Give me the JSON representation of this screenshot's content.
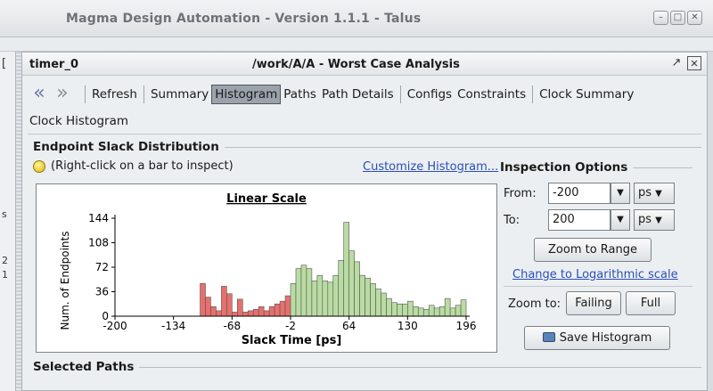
{
  "app": {
    "title": "Magma Design Automation - Version 1.1.1 - Talus",
    "window_buttons": [
      "–",
      "□",
      "✕"
    ]
  },
  "left_panel": {
    "bracket": "[",
    "fragments": [
      "s",
      "2",
      "1"
    ]
  },
  "panel": {
    "name": "timer_0",
    "title": "/work/A/A  -  Worst Case Analysis",
    "icons": [
      "restore-icon",
      "close-icon"
    ]
  },
  "toolbar": {
    "items": [
      "Refresh",
      "Summary",
      "Histogram",
      "Paths",
      "Path Details",
      "Configs",
      "Constraints",
      "Clock Summary"
    ],
    "row2_item": "Clock Histogram",
    "active": "Histogram"
  },
  "endpoint": {
    "section_title": "Endpoint Slack Distribution",
    "hint": "(Right-click on a bar to inspect)",
    "customize_link": "Customize Histogram..."
  },
  "chart_data": {
    "type": "bar",
    "title": "Linear Scale",
    "xlabel": "Slack Time [ps]",
    "ylabel": "Num. of Endpoints",
    "ylim": [
      0,
      144
    ],
    "xlim": [
      -200,
      200
    ],
    "y_ticks": [
      "144",
      "108",
      "72",
      "36",
      "0"
    ],
    "x_ticks": [
      "-200",
      "-134",
      "-68",
      "-2",
      "64",
      "130",
      "196"
    ],
    "grid": false,
    "colors": {
      "failing": "#e8706c",
      "passing": "#b9dca2",
      "outline": "#555555"
    },
    "bin_width": 6,
    "bins": [
      {
        "x": -101,
        "value": 48,
        "failing": true
      },
      {
        "x": -95,
        "value": 28,
        "failing": true
      },
      {
        "x": -89,
        "value": 14,
        "failing": true
      },
      {
        "x": -83,
        "value": 8,
        "failing": true
      },
      {
        "x": -77,
        "value": 44,
        "failing": true
      },
      {
        "x": -71,
        "value": 33,
        "failing": true
      },
      {
        "x": -65,
        "value": 6,
        "failing": true
      },
      {
        "x": -59,
        "value": 25,
        "failing": true
      },
      {
        "x": -53,
        "value": 6,
        "failing": true
      },
      {
        "x": -47,
        "value": 8,
        "failing": true
      },
      {
        "x": -41,
        "value": 10,
        "failing": true
      },
      {
        "x": -35,
        "value": 14,
        "failing": true
      },
      {
        "x": -29,
        "value": 8,
        "failing": true
      },
      {
        "x": -23,
        "value": 14,
        "failing": true
      },
      {
        "x": -17,
        "value": 18,
        "failing": true
      },
      {
        "x": -11,
        "value": 22,
        "failing": true
      },
      {
        "x": -5,
        "value": 30,
        "failing": true
      },
      {
        "x": 1,
        "value": 48,
        "failing": false
      },
      {
        "x": 7,
        "value": 70,
        "failing": false
      },
      {
        "x": 13,
        "value": 75,
        "failing": false
      },
      {
        "x": 19,
        "value": 70,
        "failing": false
      },
      {
        "x": 25,
        "value": 52,
        "failing": false
      },
      {
        "x": 31,
        "value": 60,
        "failing": false
      },
      {
        "x": 37,
        "value": 52,
        "failing": false
      },
      {
        "x": 43,
        "value": 50,
        "failing": false
      },
      {
        "x": 49,
        "value": 60,
        "failing": false
      },
      {
        "x": 55,
        "value": 82,
        "failing": false
      },
      {
        "x": 61,
        "value": 138,
        "failing": false
      },
      {
        "x": 67,
        "value": 96,
        "failing": false
      },
      {
        "x": 73,
        "value": 80,
        "failing": false
      },
      {
        "x": 79,
        "value": 60,
        "failing": false
      },
      {
        "x": 85,
        "value": 56,
        "failing": false
      },
      {
        "x": 91,
        "value": 48,
        "failing": false
      },
      {
        "x": 97,
        "value": 40,
        "failing": false
      },
      {
        "x": 103,
        "value": 34,
        "failing": false
      },
      {
        "x": 109,
        "value": 26,
        "failing": false
      },
      {
        "x": 115,
        "value": 20,
        "failing": false
      },
      {
        "x": 121,
        "value": 18,
        "failing": false
      },
      {
        "x": 127,
        "value": 18,
        "failing": false
      },
      {
        "x": 133,
        "value": 22,
        "failing": false
      },
      {
        "x": 139,
        "value": 14,
        "failing": false
      },
      {
        "x": 145,
        "value": 12,
        "failing": false
      },
      {
        "x": 151,
        "value": 10,
        "failing": false
      },
      {
        "x": 157,
        "value": 16,
        "failing": false
      },
      {
        "x": 163,
        "value": 12,
        "failing": false
      },
      {
        "x": 169,
        "value": 14,
        "failing": false
      },
      {
        "x": 175,
        "value": 26,
        "failing": false
      },
      {
        "x": 181,
        "value": 12,
        "failing": false
      },
      {
        "x": 187,
        "value": 16,
        "failing": false
      },
      {
        "x": 193,
        "value": 24,
        "failing": false
      }
    ]
  },
  "inspection": {
    "title": "Inspection Options",
    "from_label": "From:",
    "from_value": "-200",
    "from_unit": "ps",
    "to_label": "To:",
    "to_value": "200",
    "to_unit": "ps",
    "zoom_range_button": "Zoom to Range",
    "log_scale_link": "Change to Logarithmic scale",
    "zoom_to_label": "Zoom to:",
    "failing_button": "Failing",
    "full_button": "Full",
    "save_button": "Save Histogram"
  },
  "selected_paths": {
    "title": "Selected Paths"
  }
}
